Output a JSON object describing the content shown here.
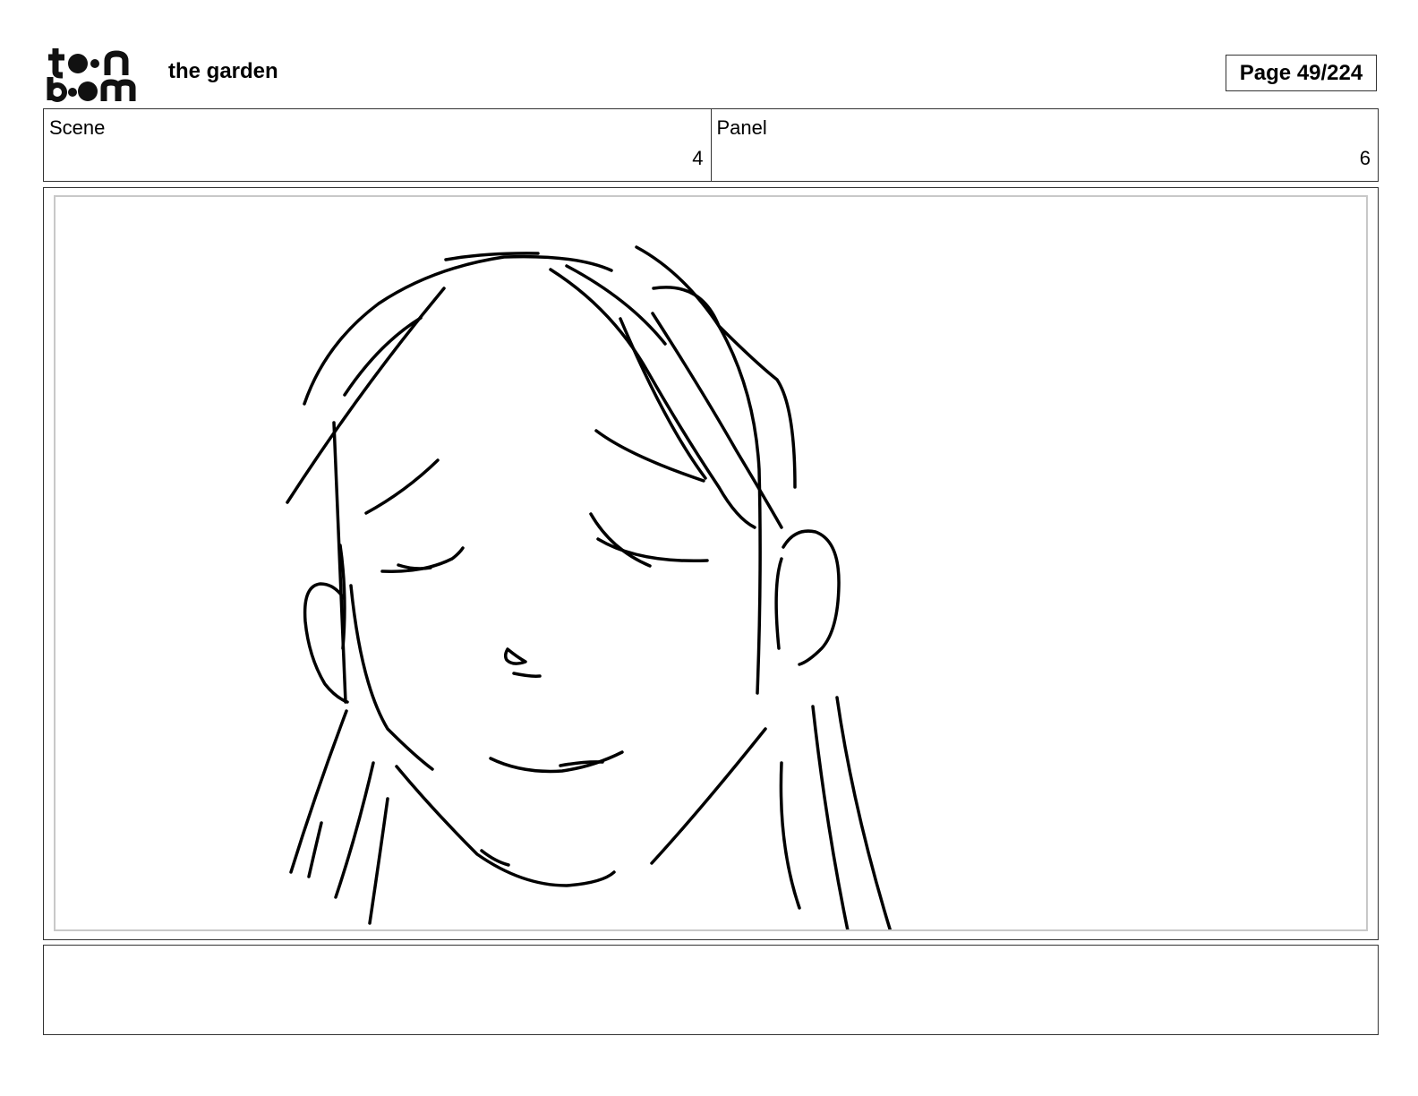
{
  "header": {
    "logo": {
      "line1": "toon",
      "line2": "boom"
    },
    "project_title": "the garden",
    "page_label": "Page",
    "page_number": "49/224"
  },
  "panel_info": {
    "scene_label": "Scene",
    "scene_value": "4",
    "panel_label": "Panel",
    "panel_value": "6"
  },
  "drawing": {
    "subject": "sketch-girl-face-eyes-closed",
    "stroke_color": "#000000",
    "frame_border_color": "#c8c8c8"
  },
  "notes": {
    "text": ""
  }
}
